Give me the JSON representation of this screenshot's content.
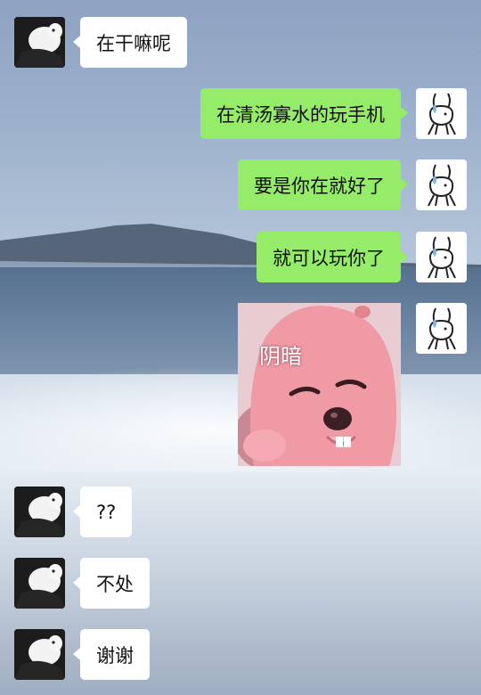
{
  "messages": [
    {
      "side": "left",
      "type": "text",
      "text": "在干嘛呢",
      "avatar": "cat-avatar"
    },
    {
      "side": "right",
      "type": "text",
      "text": "在清汤寡水的玩手机",
      "avatar": "bunny-avatar"
    },
    {
      "side": "right",
      "type": "text",
      "text": "要是你在就好了",
      "avatar": "bunny-avatar"
    },
    {
      "side": "right",
      "type": "text",
      "text": "就可以玩你了",
      "avatar": "bunny-avatar"
    },
    {
      "side": "right",
      "type": "sticker",
      "caption": "阴暗",
      "avatar": "bunny-avatar",
      "sticker": "pink-beaver-sticker"
    },
    {
      "side": "left",
      "type": "text",
      "text": "??",
      "avatar": "cat-avatar"
    },
    {
      "side": "left",
      "type": "text",
      "text": "不处",
      "avatar": "cat-avatar"
    },
    {
      "side": "left",
      "type": "text",
      "text": "谢谢",
      "avatar": "cat-avatar"
    }
  ],
  "colors": {
    "sent_bubble": "#95ec69",
    "received_bubble": "#ffffff"
  }
}
